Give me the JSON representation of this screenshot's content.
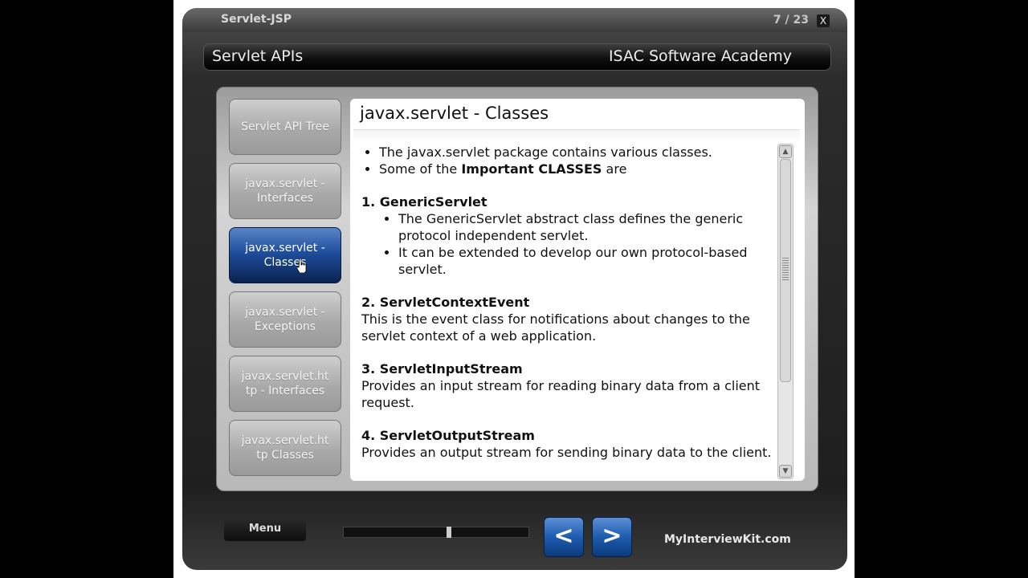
{
  "player": {
    "course_title": "Servlet-JSP",
    "page_counter": "7 / 23",
    "close_label": "X",
    "section_title": "Servlet APIs",
    "academy": "ISAC Software Academy"
  },
  "nav": {
    "items": [
      {
        "label": "Servlet API Tree",
        "active": false
      },
      {
        "label": "javax.servlet - Interfaces",
        "active": false
      },
      {
        "label": "javax.servlet - Classes",
        "active": true
      },
      {
        "label": "javax.servlet - Exceptions",
        "active": false
      },
      {
        "label": "javax.servlet.ht tp - Interfaces",
        "active": false
      },
      {
        "label": "javax.servlet.ht tp Classes",
        "active": false
      }
    ]
  },
  "content": {
    "title": "javax.servlet - Classes",
    "intro": [
      "The javax.servlet package contains various classes.",
      "Some of the"
    ],
    "intro_bold": "Important CLASSES",
    "intro_tail": " are",
    "classes": [
      {
        "heading": "1. GenericServlet",
        "bullets": [
          "The GenericServlet abstract class defines the generic protocol independent servlet.",
          "It can be extended to develop our own protocol-based servlet."
        ]
      },
      {
        "heading": "2. ServletContextEvent",
        "desc": "This is the event class for notifications about changes to the servlet context of a web application."
      },
      {
        "heading": "3. ServletInputStream",
        "desc": "Provides an input stream for reading binary data from a client request."
      },
      {
        "heading": "4. ServletOutputStream",
        "desc": "Provides an output stream for sending binary data to the client."
      }
    ]
  },
  "footer": {
    "menu_label": "Menu",
    "prev_icon": "<",
    "next_icon": ">",
    "brand": "MyInterviewKit.com",
    "progress": 0.57
  },
  "colors": {
    "accent_active": "#1f4e9c",
    "nav_inactive": "#a9a9a9",
    "player_bg": "#2c2c2c"
  }
}
